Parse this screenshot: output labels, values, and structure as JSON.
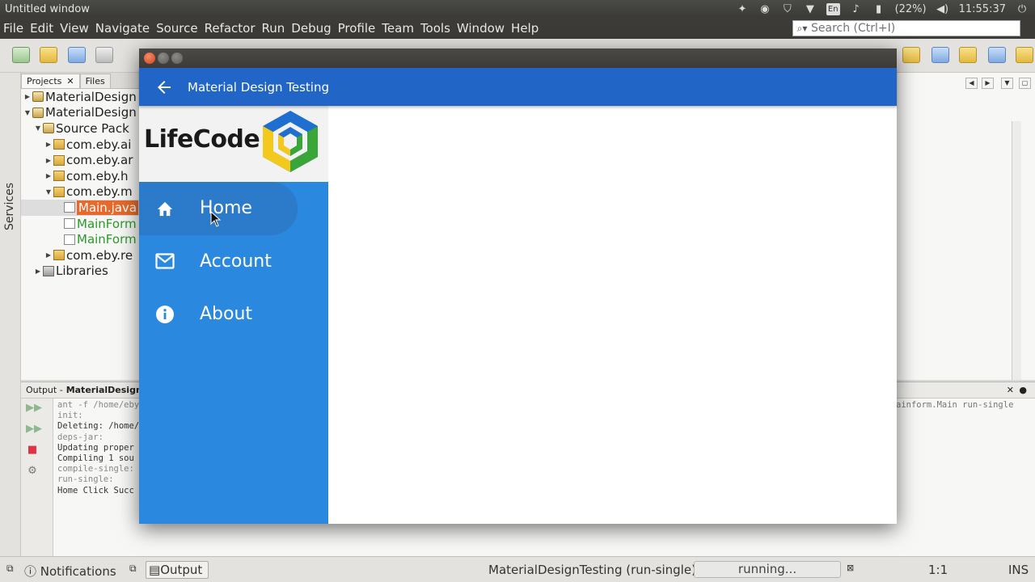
{
  "os": {
    "window_title": "Untitled window",
    "tray": {
      "lang": "En",
      "battery": "(22%)",
      "clock": "11:55:37"
    }
  },
  "ide": {
    "menus": [
      "File",
      "Edit",
      "View",
      "Navigate",
      "Source",
      "Refactor",
      "Run",
      "Debug",
      "Profile",
      "Team",
      "Tools",
      "Window",
      "Help"
    ],
    "search_placeholder": "Search (Ctrl+I)",
    "side_label": "Services",
    "panel_tabs": {
      "projects": "Projects",
      "files": "Files"
    },
    "tree": [
      {
        "label": "MaterialDesign",
        "depth": 0,
        "expanded": false,
        "type": "project"
      },
      {
        "label": "MaterialDesign",
        "depth": 0,
        "expanded": true,
        "type": "project"
      },
      {
        "label": "Source Pack",
        "depth": 1,
        "expanded": true,
        "type": "src"
      },
      {
        "label": "com.eby.ai",
        "depth": 2,
        "expanded": false,
        "type": "pkg"
      },
      {
        "label": "com.eby.ar",
        "depth": 2,
        "expanded": false,
        "type": "pkg"
      },
      {
        "label": "com.eby.h",
        "depth": 2,
        "expanded": false,
        "type": "pkg"
      },
      {
        "label": "com.eby.m",
        "depth": 2,
        "expanded": true,
        "type": "pkg"
      },
      {
        "label": "Main.java",
        "depth": 3,
        "type": "file",
        "selected": true
      },
      {
        "label": "MainForm",
        "depth": 3,
        "type": "file",
        "green": true
      },
      {
        "label": "MainForm",
        "depth": 3,
        "type": "file",
        "green": true
      },
      {
        "label": "com.eby.re",
        "depth": 2,
        "expanded": false,
        "type": "pkg"
      },
      {
        "label": "Libraries",
        "depth": 1,
        "expanded": false,
        "type": "lib"
      }
    ],
    "output": {
      "title_prefix": "Output - ",
      "title_project": "MaterialDesign",
      "lines": [
        {
          "text": "ant -f /home/eby",
          "dim": true
        },
        {
          "text": "init:",
          "dim": true
        },
        {
          "text": "Deleting: /home/",
          "dim": false
        },
        {
          "text": "deps-jar:",
          "dim": true
        },
        {
          "text": "Updating proper",
          "dim": false
        },
        {
          "text": "Compiling 1 sou",
          "dim": false
        },
        {
          "text": "compile-single:",
          "dim": true
        },
        {
          "text": "run-single:",
          "dim": true
        },
        {
          "text": "Home Click Succ",
          "dim": false
        }
      ],
      "right_fragment": "ainform.Main run-single"
    },
    "status": {
      "notifications": "Notifications",
      "output_tab": "Output",
      "running_task": "MaterialDesignTesting (run-single)",
      "progress_text": "running...",
      "position": "1:1",
      "insert_mode": "INS"
    }
  },
  "app": {
    "title": "Material Design Testing",
    "logo_text": "LifeCode",
    "colors": {
      "app_bar": "#2166c7",
      "drawer": "#2a88df",
      "active": "#2d6fb8",
      "logo_blue": "#1e6fd0",
      "logo_yellow": "#f2c91c",
      "logo_green": "#3aa63a"
    },
    "nav": [
      {
        "label": "Home",
        "icon": "home-icon",
        "active": true
      },
      {
        "label": "Account",
        "icon": "mail-icon",
        "active": false
      },
      {
        "label": "About",
        "icon": "info-icon",
        "active": false
      }
    ]
  }
}
